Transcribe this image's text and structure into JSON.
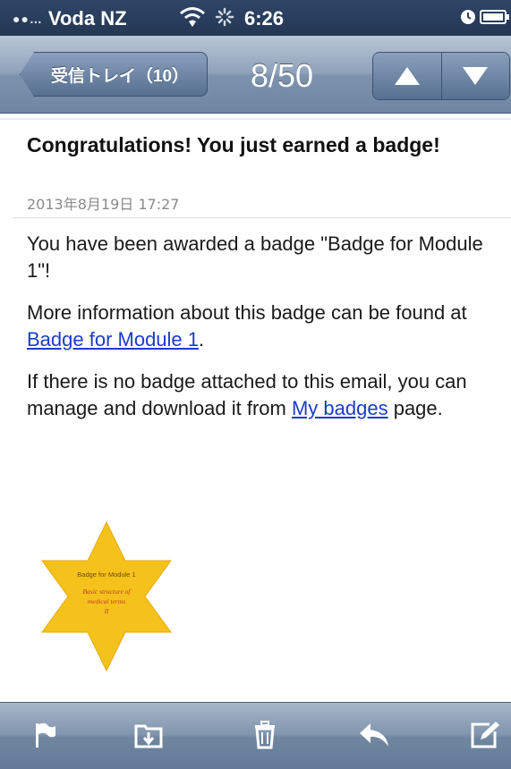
{
  "status_bar": {
    "signal_dots": "●●…",
    "carrier": "Voda NZ",
    "time": "6:26"
  },
  "nav": {
    "back_label": "受信トレイ（10）",
    "title": "8/50"
  },
  "email": {
    "subject": "Congratulations! You just earned a badge!",
    "date": "2013年8月19日 17:27",
    "para1": "You have been awarded a badge \"Badge for Module 1\"!",
    "para2_prefix": "More information about this badge can be found at ",
    "para2_link": "Badge for Module 1",
    "para2_suffix": ".",
    "para3_prefix": "If there is no badge attached to this email, you can manage and download it from ",
    "para3_link": "My badges",
    "para3_suffix": " page."
  },
  "badge": {
    "title": "Badge for Module 1",
    "line1": "Basic structure of",
    "line2": "medical terms",
    "line3": "II",
    "color": "#f5c21b"
  },
  "toolbar": {
    "icons": [
      "flag-icon",
      "move-folder-icon",
      "trash-icon",
      "reply-icon",
      "compose-icon"
    ]
  },
  "colors": {
    "nav_bar": "#7d92ad",
    "link": "#1a3cc8",
    "status_bar": "#2f4566"
  }
}
